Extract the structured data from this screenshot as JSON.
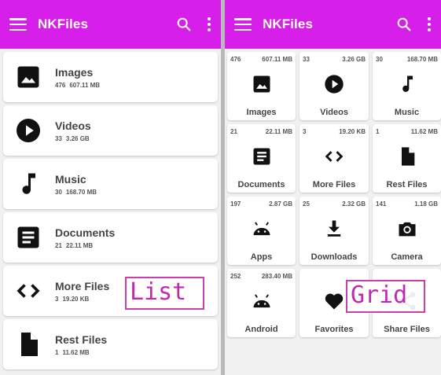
{
  "app": {
    "title": "NKFiles"
  },
  "accent_color": "#d61fe8",
  "list_view": {
    "items": [
      {
        "name": "Images",
        "count": "476",
        "size": "607.11 MB",
        "icon": "image-icon"
      },
      {
        "name": "Videos",
        "count": "33",
        "size": "3.26 GB",
        "icon": "play-circle-icon"
      },
      {
        "name": "Music",
        "count": "30",
        "size": "168.70 MB",
        "icon": "music-note-icon"
      },
      {
        "name": "Documents",
        "count": "21",
        "size": "22.11 MB",
        "icon": "document-icon"
      },
      {
        "name": "More Files",
        "count": "3",
        "size": "19.20 KB",
        "icon": "code-icon"
      },
      {
        "name": "Rest Files",
        "count": "1",
        "size": "11.62 MB",
        "icon": "file-icon"
      }
    ],
    "annotation": "List"
  },
  "grid_view": {
    "items": [
      {
        "name": "Images",
        "count": "476",
        "size": "607.11 MB",
        "icon": "image-icon"
      },
      {
        "name": "Videos",
        "count": "33",
        "size": "3.26 GB",
        "icon": "play-circle-icon"
      },
      {
        "name": "Music",
        "count": "30",
        "size": "168.70 MB",
        "icon": "music-note-icon"
      },
      {
        "name": "Documents",
        "count": "21",
        "size": "22.11 MB",
        "icon": "document-icon"
      },
      {
        "name": "More Files",
        "count": "3",
        "size": "19.20 KB",
        "icon": "code-icon"
      },
      {
        "name": "Rest Files",
        "count": "1",
        "size": "11.62 MB",
        "icon": "file-icon"
      },
      {
        "name": "Apps",
        "count": "197",
        "size": "2.87 GB",
        "icon": "android-icon"
      },
      {
        "name": "Downloads",
        "count": "25",
        "size": "2.32 GB",
        "icon": "download-icon"
      },
      {
        "name": "Camera",
        "count": "141",
        "size": "1.18 GB",
        "icon": "camera-icon"
      },
      {
        "name": "Android",
        "count": "252",
        "size": "283.40 MB",
        "icon": "android-icon"
      },
      {
        "name": "Favorites",
        "count": "",
        "size": "",
        "icon": "heart-icon"
      },
      {
        "name": "Share Files",
        "count": "",
        "size": "",
        "icon": "share-icon"
      }
    ],
    "annotation": "Grid"
  }
}
